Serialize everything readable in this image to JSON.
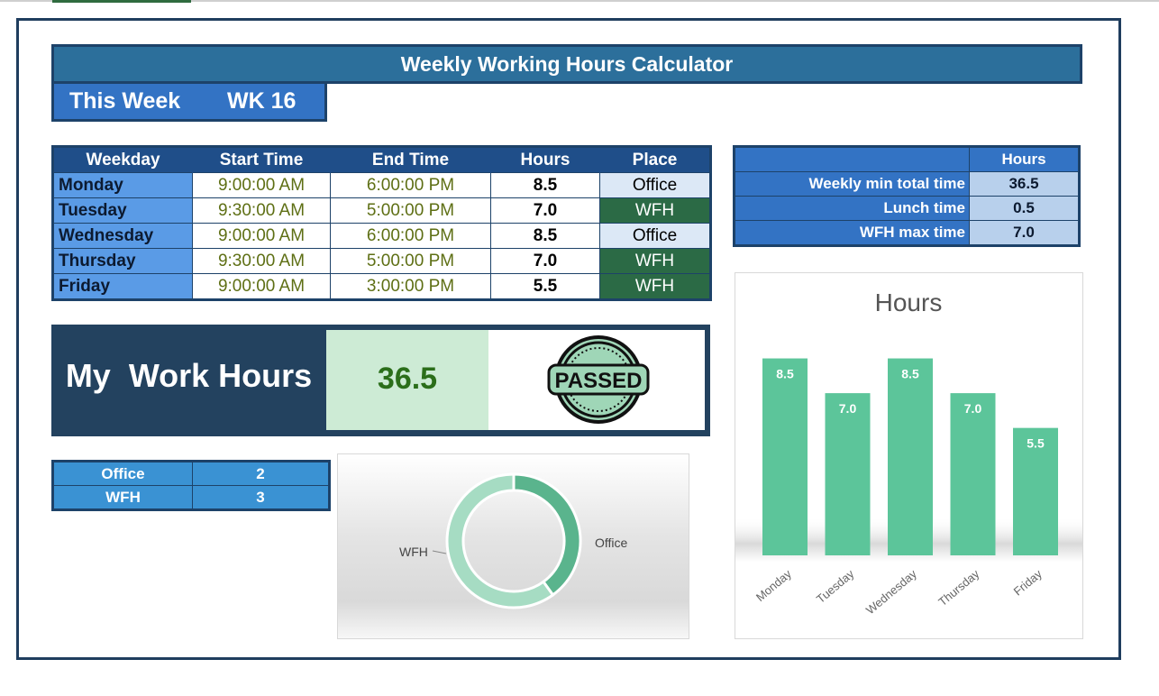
{
  "title": "Weekly Working Hours Calculator",
  "week": {
    "label": "This Week",
    "value": "WK 16"
  },
  "schedule": {
    "headers": [
      "Weekday",
      "Start Time",
      "End Time",
      "Hours",
      "Place"
    ],
    "rows": [
      {
        "day": "Monday",
        "start": "9:00:00 AM",
        "end": "6:00:00 PM",
        "hours": "8.5",
        "place": "Office"
      },
      {
        "day": "Tuesday",
        "start": "9:30:00 AM",
        "end": "5:00:00 PM",
        "hours": "7.0",
        "place": "WFH"
      },
      {
        "day": "Wednesday",
        "start": "9:00:00 AM",
        "end": "6:00:00 PM",
        "hours": "8.5",
        "place": "Office"
      },
      {
        "day": "Thursday",
        "start": "9:30:00 AM",
        "end": "5:00:00 PM",
        "hours": "7.0",
        "place": "WFH"
      },
      {
        "day": "Friday",
        "start": "9:00:00 AM",
        "end": "3:00:00 PM",
        "hours": "5.5",
        "place": "WFH"
      }
    ]
  },
  "settings": {
    "header": "Hours",
    "rows": [
      {
        "label": "Weekly min total time",
        "value": "36.5"
      },
      {
        "label": "Lunch time",
        "value": "0.5"
      },
      {
        "label": "WFH max time",
        "value": "7.0"
      }
    ]
  },
  "summary": {
    "label": "My  Work Hours",
    "value": "36.5",
    "stamp_text": "PASSED",
    "stamp_icon": "passed-stamp-icon"
  },
  "counts": [
    {
      "label": "Office",
      "value": "2"
    },
    {
      "label": "WFH",
      "value": "3"
    }
  ],
  "colors": {
    "accent": "#2c6f9b",
    "wfh": "#2b6a45",
    "bar": "#5cc59a"
  },
  "chart_data": [
    {
      "type": "pie",
      "variant": "donut",
      "categories": [
        "Office",
        "WFH"
      ],
      "values": [
        2,
        3
      ],
      "title": "",
      "legend": "none",
      "colors": [
        "#5ab48d",
        "#a6dcc3"
      ]
    },
    {
      "type": "bar",
      "title": "Hours",
      "categories": [
        "Monday",
        "Tuesday",
        "Wednesday",
        "Thursday",
        "Friday"
      ],
      "values": [
        8.5,
        7.0,
        8.5,
        7.0,
        5.5
      ],
      "value_labels": [
        "8.5",
        "7.0",
        "8.5",
        "7.0",
        "5.5"
      ],
      "xlabel": "",
      "ylabel": "",
      "ylim": [
        0,
        10
      ],
      "grid": false,
      "legend": "none",
      "colors": [
        "#5cc59a"
      ]
    }
  ]
}
